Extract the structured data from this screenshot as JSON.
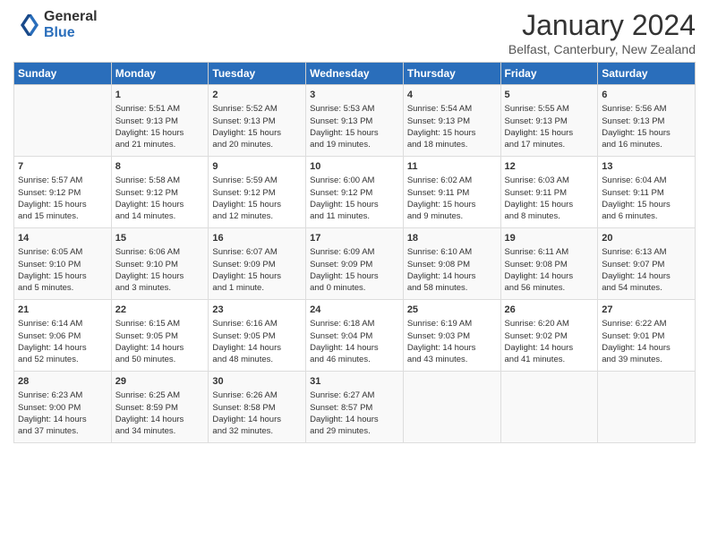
{
  "header": {
    "logo_general": "General",
    "logo_blue": "Blue",
    "title": "January 2024",
    "location": "Belfast, Canterbury, New Zealand"
  },
  "calendar": {
    "days_of_week": [
      "Sunday",
      "Monday",
      "Tuesday",
      "Wednesday",
      "Thursday",
      "Friday",
      "Saturday"
    ],
    "weeks": [
      [
        {
          "day": "",
          "content": ""
        },
        {
          "day": "1",
          "content": "Sunrise: 5:51 AM\nSunset: 9:13 PM\nDaylight: 15 hours\nand 21 minutes."
        },
        {
          "day": "2",
          "content": "Sunrise: 5:52 AM\nSunset: 9:13 PM\nDaylight: 15 hours\nand 20 minutes."
        },
        {
          "day": "3",
          "content": "Sunrise: 5:53 AM\nSunset: 9:13 PM\nDaylight: 15 hours\nand 19 minutes."
        },
        {
          "day": "4",
          "content": "Sunrise: 5:54 AM\nSunset: 9:13 PM\nDaylight: 15 hours\nand 18 minutes."
        },
        {
          "day": "5",
          "content": "Sunrise: 5:55 AM\nSunset: 9:13 PM\nDaylight: 15 hours\nand 17 minutes."
        },
        {
          "day": "6",
          "content": "Sunrise: 5:56 AM\nSunset: 9:13 PM\nDaylight: 15 hours\nand 16 minutes."
        }
      ],
      [
        {
          "day": "7",
          "content": "Sunrise: 5:57 AM\nSunset: 9:12 PM\nDaylight: 15 hours\nand 15 minutes."
        },
        {
          "day": "8",
          "content": "Sunrise: 5:58 AM\nSunset: 9:12 PM\nDaylight: 15 hours\nand 14 minutes."
        },
        {
          "day": "9",
          "content": "Sunrise: 5:59 AM\nSunset: 9:12 PM\nDaylight: 15 hours\nand 12 minutes."
        },
        {
          "day": "10",
          "content": "Sunrise: 6:00 AM\nSunset: 9:12 PM\nDaylight: 15 hours\nand 11 minutes."
        },
        {
          "day": "11",
          "content": "Sunrise: 6:02 AM\nSunset: 9:11 PM\nDaylight: 15 hours\nand 9 minutes."
        },
        {
          "day": "12",
          "content": "Sunrise: 6:03 AM\nSunset: 9:11 PM\nDaylight: 15 hours\nand 8 minutes."
        },
        {
          "day": "13",
          "content": "Sunrise: 6:04 AM\nSunset: 9:11 PM\nDaylight: 15 hours\nand 6 minutes."
        }
      ],
      [
        {
          "day": "14",
          "content": "Sunrise: 6:05 AM\nSunset: 9:10 PM\nDaylight: 15 hours\nand 5 minutes."
        },
        {
          "day": "15",
          "content": "Sunrise: 6:06 AM\nSunset: 9:10 PM\nDaylight: 15 hours\nand 3 minutes."
        },
        {
          "day": "16",
          "content": "Sunrise: 6:07 AM\nSunset: 9:09 PM\nDaylight: 15 hours\nand 1 minute."
        },
        {
          "day": "17",
          "content": "Sunrise: 6:09 AM\nSunset: 9:09 PM\nDaylight: 15 hours\nand 0 minutes."
        },
        {
          "day": "18",
          "content": "Sunrise: 6:10 AM\nSunset: 9:08 PM\nDaylight: 14 hours\nand 58 minutes."
        },
        {
          "day": "19",
          "content": "Sunrise: 6:11 AM\nSunset: 9:08 PM\nDaylight: 14 hours\nand 56 minutes."
        },
        {
          "day": "20",
          "content": "Sunrise: 6:13 AM\nSunset: 9:07 PM\nDaylight: 14 hours\nand 54 minutes."
        }
      ],
      [
        {
          "day": "21",
          "content": "Sunrise: 6:14 AM\nSunset: 9:06 PM\nDaylight: 14 hours\nand 52 minutes."
        },
        {
          "day": "22",
          "content": "Sunrise: 6:15 AM\nSunset: 9:05 PM\nDaylight: 14 hours\nand 50 minutes."
        },
        {
          "day": "23",
          "content": "Sunrise: 6:16 AM\nSunset: 9:05 PM\nDaylight: 14 hours\nand 48 minutes."
        },
        {
          "day": "24",
          "content": "Sunrise: 6:18 AM\nSunset: 9:04 PM\nDaylight: 14 hours\nand 46 minutes."
        },
        {
          "day": "25",
          "content": "Sunrise: 6:19 AM\nSunset: 9:03 PM\nDaylight: 14 hours\nand 43 minutes."
        },
        {
          "day": "26",
          "content": "Sunrise: 6:20 AM\nSunset: 9:02 PM\nDaylight: 14 hours\nand 41 minutes."
        },
        {
          "day": "27",
          "content": "Sunrise: 6:22 AM\nSunset: 9:01 PM\nDaylight: 14 hours\nand 39 minutes."
        }
      ],
      [
        {
          "day": "28",
          "content": "Sunrise: 6:23 AM\nSunset: 9:00 PM\nDaylight: 14 hours\nand 37 minutes."
        },
        {
          "day": "29",
          "content": "Sunrise: 6:25 AM\nSunset: 8:59 PM\nDaylight: 14 hours\nand 34 minutes."
        },
        {
          "day": "30",
          "content": "Sunrise: 6:26 AM\nSunset: 8:58 PM\nDaylight: 14 hours\nand 32 minutes."
        },
        {
          "day": "31",
          "content": "Sunrise: 6:27 AM\nSunset: 8:57 PM\nDaylight: 14 hours\nand 29 minutes."
        },
        {
          "day": "",
          "content": ""
        },
        {
          "day": "",
          "content": ""
        },
        {
          "day": "",
          "content": ""
        }
      ]
    ]
  }
}
